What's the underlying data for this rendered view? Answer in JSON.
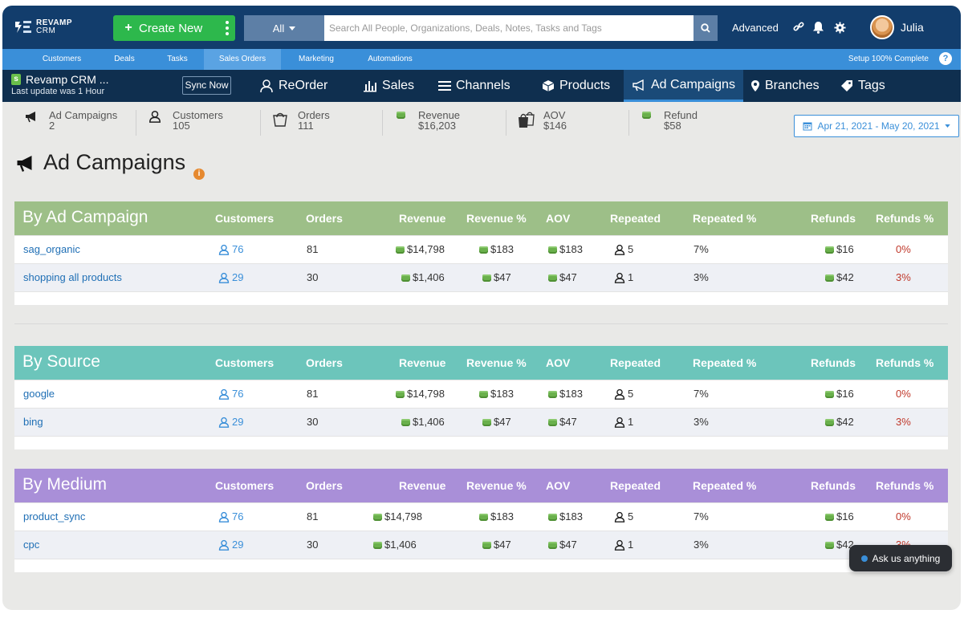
{
  "header": {
    "logo_text_1": "REVAMP",
    "logo_text_2": "CRM",
    "create_new_label": "Create New",
    "search_scope": "All",
    "search_placeholder": "Search All People, Organizations, Deals, Notes, Tasks and Tags",
    "advanced_label": "Advanced",
    "user_name": "Julia"
  },
  "subnav": {
    "items": [
      {
        "label": "Customers"
      },
      {
        "label": "Deals"
      },
      {
        "label": "Tasks"
      },
      {
        "label": "Sales Orders"
      },
      {
        "label": "Marketing"
      },
      {
        "label": "Automations"
      }
    ],
    "active": "Sales Orders",
    "setup_label": "Setup 100% Complete",
    "help_glyph": "?"
  },
  "appbar": {
    "store_name": "Revamp CRM ...",
    "last_update": "Last update was 1 Hour",
    "sync_label": "Sync Now",
    "tabs": [
      {
        "label": "ReOrder",
        "icon": "reorder-user-icon"
      },
      {
        "label": "Sales",
        "icon": "bar-chart-icon"
      },
      {
        "label": "Channels",
        "icon": "list-icon"
      },
      {
        "label": "Products",
        "icon": "box-icon"
      },
      {
        "label": "Ad Campaigns",
        "icon": "megaphone-icon"
      },
      {
        "label": "Branches",
        "icon": "map-pin-icon"
      },
      {
        "label": "Tags",
        "icon": "tag-icon"
      }
    ],
    "active_tab": "Ad Campaigns"
  },
  "stats": [
    {
      "label": "Ad Campaigns",
      "value": "2"
    },
    {
      "label": "Customers",
      "value": "105"
    },
    {
      "label": "Orders",
      "value": "111"
    },
    {
      "label": "Revenue",
      "value": "$16,203"
    },
    {
      "label": "AOV",
      "value": "$146"
    },
    {
      "label": "Refund",
      "value": "$58"
    }
  ],
  "date_range": "Apr 21, 2021 - May 20, 2021",
  "page_title": "Ad Campaigns",
  "info_glyph": "i",
  "columns": [
    "Customers",
    "Orders",
    "Revenue",
    "Revenue %",
    "AOV",
    "Repeated",
    "Repeated %",
    "Refunds",
    "Refunds %"
  ],
  "panels": [
    {
      "title": "By Ad Campaign",
      "color": "#9dbf88",
      "rows": [
        {
          "name": "sag_organic",
          "customers": "76",
          "orders": "81",
          "revenue": "$14,798",
          "revenue_pct": "$183",
          "aov": "$183",
          "repeated": "5",
          "repeated_pct": "7%",
          "refunds": "$16",
          "refunds_pct": "0%"
        },
        {
          "name": "shopping all products",
          "customers": "29",
          "orders": "30",
          "revenue": "$1,406",
          "revenue_pct": "$47",
          "aov": "$47",
          "repeated": "1",
          "repeated_pct": "3%",
          "refunds": "$42",
          "refunds_pct": "3%"
        }
      ]
    },
    {
      "title": "By Source",
      "color": "#6cc5bb",
      "rows": [
        {
          "name": "google",
          "customers": "76",
          "orders": "81",
          "revenue": "$14,798",
          "revenue_pct": "$183",
          "aov": "$183",
          "repeated": "5",
          "repeated_pct": "7%",
          "refunds": "$16",
          "refunds_pct": "0%"
        },
        {
          "name": "bing",
          "customers": "29",
          "orders": "30",
          "revenue": "$1,406",
          "revenue_pct": "$47",
          "aov": "$47",
          "repeated": "1",
          "repeated_pct": "3%",
          "refunds": "$42",
          "refunds_pct": "3%"
        }
      ]
    },
    {
      "title": "By Medium",
      "color": "#a98fd8",
      "rows": [
        {
          "name": "product_sync",
          "customers": "76",
          "orders": "81",
          "revenue": "$14,798",
          "revenue_pct": "$183",
          "aov": "$183",
          "repeated": "5",
          "repeated_pct": "7%",
          "refunds": "$16",
          "refunds_pct": "0%"
        },
        {
          "name": "cpc",
          "customers": "29",
          "orders": "30",
          "revenue": "$1,406",
          "revenue_pct": "$47",
          "aov": "$47",
          "repeated": "1",
          "repeated_pct": "3%",
          "refunds": "$42",
          "refunds_pct": "3%"
        }
      ]
    }
  ],
  "chat_label": "Ask us anything",
  "colors": {
    "topbar": "#123d6c",
    "subnav": "#3a8fd9",
    "appbar": "#0f2f4f",
    "create_button": "#2db84c",
    "link": "#1f6fb5",
    "refund_pct": "#c0392b"
  }
}
